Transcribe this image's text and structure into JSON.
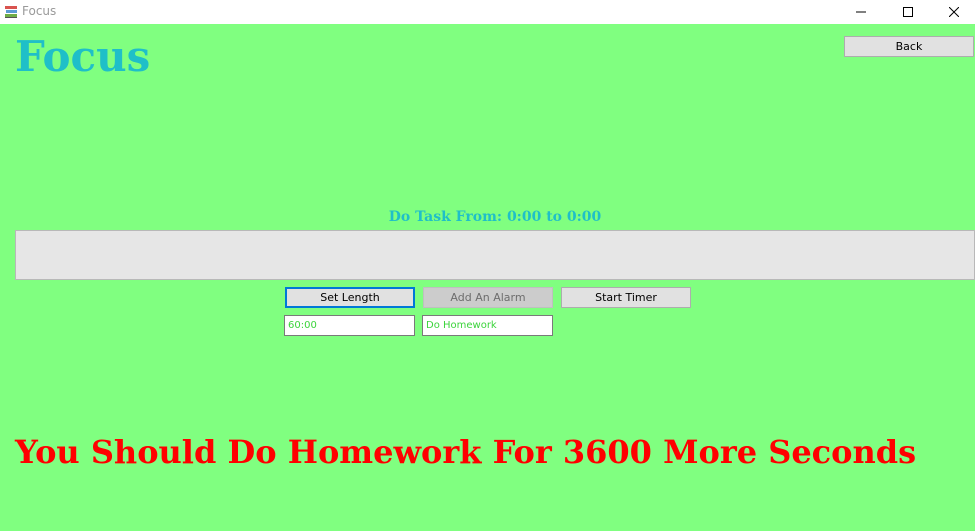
{
  "window": {
    "title": "Focus",
    "icon": "books-icon"
  },
  "app": {
    "heading": "Focus",
    "back_label": "Back",
    "task_range": "Do Task From: 0:00 to 0:00",
    "buttons": {
      "set_length": "Set Length",
      "add_alarm": "Add An Alarm",
      "start_timer": "Start Timer"
    },
    "inputs": {
      "length_value": "60:00",
      "task_value": "Do Homework"
    },
    "message": "You Should Do Homework For 3600 More Seconds"
  },
  "colors": {
    "background": "#80ff80",
    "heading": "#1fbfc8",
    "message": "#ff0000",
    "input_text": "#3cd43c",
    "focus_border": "#0078d7"
  }
}
